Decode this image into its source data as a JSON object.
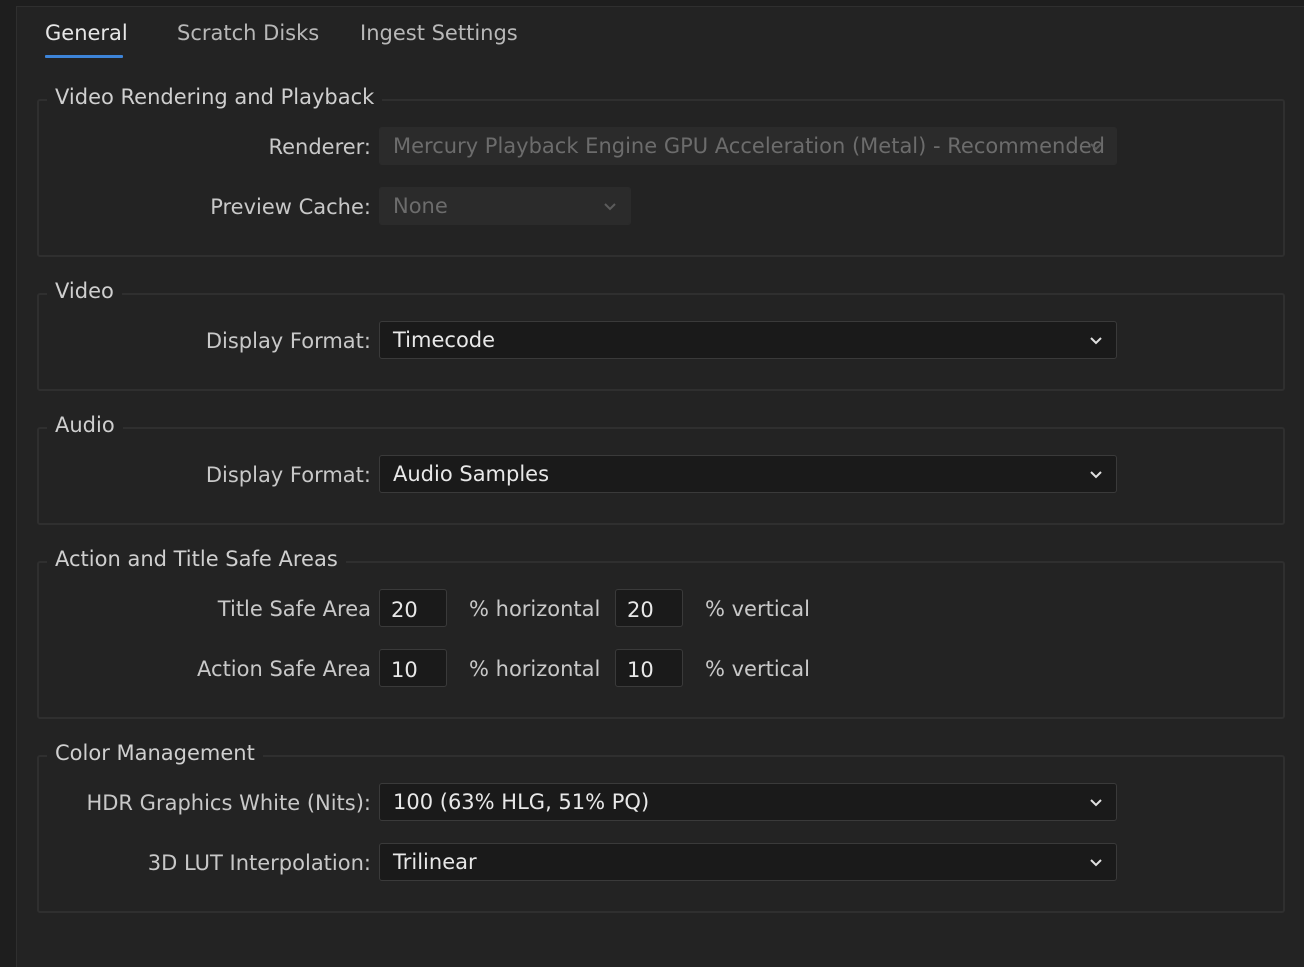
{
  "tabs": [
    {
      "label": "General",
      "active": true
    },
    {
      "label": "Scratch Disks",
      "active": false
    },
    {
      "label": "Ingest Settings",
      "active": false
    }
  ],
  "video_rendering": {
    "title": "Video Rendering and Playback",
    "renderer_label": "Renderer:",
    "renderer_value": "Mercury Playback Engine GPU Acceleration (Metal) - Recommended",
    "preview_cache_label": "Preview Cache:",
    "preview_cache_value": "None"
  },
  "video": {
    "title": "Video",
    "display_format_label": "Display Format:",
    "display_format_value": "Timecode"
  },
  "audio": {
    "title": "Audio",
    "display_format_label": "Display Format:",
    "display_format_value": "Audio Samples"
  },
  "safe_areas": {
    "title": "Action and Title Safe Areas",
    "title_safe_label": "Title Safe Area",
    "title_safe_horizontal": "20",
    "title_safe_vertical": "20",
    "action_safe_label": "Action Safe Area",
    "action_safe_horizontal": "10",
    "action_safe_vertical": "10",
    "horizontal_unit": "% horizontal",
    "vertical_unit": "% vertical"
  },
  "color_management": {
    "title": "Color Management",
    "hdr_white_label": "HDR Graphics White (Nits):",
    "hdr_white_value": "100 (63% HLG, 51% PQ)",
    "lut_label": "3D LUT Interpolation:",
    "lut_value": "Trilinear"
  },
  "colors": {
    "accent": "#3d84d8",
    "background": "#232323",
    "field": "#1a1a1a"
  },
  "icons": {
    "dropdown": "chevron-down-icon"
  }
}
